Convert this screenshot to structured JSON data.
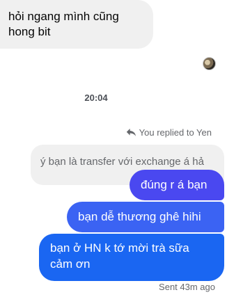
{
  "messages": {
    "incoming": "hỏi ngang mình cũng hong bit",
    "timestamp": "20:04",
    "reply_label": "You replied to Yen",
    "quoted_text": "ý bạn là transfer với exchange á hả",
    "outgoing": [
      "đúng r á bạn",
      "bạn dễ thương ghê hihi",
      "bạn ở HN k tớ mời trà sữa cảm ơn"
    ],
    "status": "Sent 43m ago"
  },
  "colors": {
    "incoming_bg": "#f0f0f0",
    "outgoing_1": "#4a48f0",
    "outgoing_2": "#3b63f3",
    "outgoing_3": "#1a66f2"
  },
  "icons": {
    "avatar": "avatar",
    "reply": "reply-arrow-icon"
  }
}
